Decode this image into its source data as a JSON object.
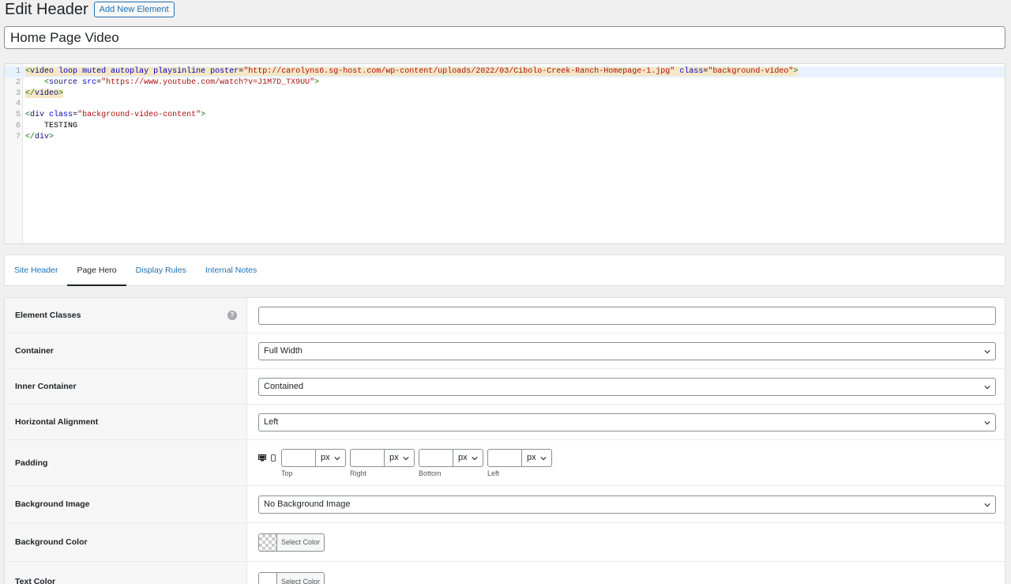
{
  "header": {
    "title": "Edit Header",
    "add_new_label": "Add New Element"
  },
  "element_title": "Home Page Video",
  "code_editor": {
    "line_numbers": [
      "1",
      "2",
      "3",
      "4",
      "5",
      "6",
      "7"
    ],
    "lines": [
      [
        {
          "t": "<",
          "c": "tag hl"
        },
        {
          "t": "video",
          "c": "tagname hl"
        },
        {
          "t": " ",
          "c": "hl"
        },
        {
          "t": "loop",
          "c": "attr hl"
        },
        {
          "t": " ",
          "c": "hl"
        },
        {
          "t": "muted",
          "c": "attr hl"
        },
        {
          "t": " ",
          "c": "hl"
        },
        {
          "t": "autoplay",
          "c": "attr hl"
        },
        {
          "t": " ",
          "c": "hl"
        },
        {
          "t": "playsinline",
          "c": "attr hl"
        },
        {
          "t": " ",
          "c": "hl"
        },
        {
          "t": "poster",
          "c": "attr hl"
        },
        {
          "t": "=",
          "c": "txt hl"
        },
        {
          "t": "\"http://carolyns6.sg-host.com/wp-content/uploads/2022/03/Cibolo-Creek-Ranch-Homepage-1.jpg\"",
          "c": "str hl"
        },
        {
          "t": " ",
          "c": "hl"
        },
        {
          "t": "class",
          "c": "attr hl"
        },
        {
          "t": "=",
          "c": "txt hl"
        },
        {
          "t": "\"background-video\"",
          "c": "str hl"
        },
        {
          "t": ">",
          "c": "tag hl"
        }
      ],
      [
        {
          "t": "    ",
          "c": "txt"
        },
        {
          "t": "<",
          "c": "tag"
        },
        {
          "t": "source",
          "c": "tagname"
        },
        {
          "t": " ",
          "c": "txt"
        },
        {
          "t": "src",
          "c": "attr"
        },
        {
          "t": "=",
          "c": "txt"
        },
        {
          "t": "\"https://www.youtube.com/watch?v=J1M7D_TX9UU\"",
          "c": "str"
        },
        {
          "t": ">",
          "c": "tag"
        }
      ],
      [
        {
          "t": "</",
          "c": "tag hl"
        },
        {
          "t": "video",
          "c": "tagname hl"
        },
        {
          "t": ">",
          "c": "tag hl"
        }
      ],
      [],
      [
        {
          "t": "<",
          "c": "tag"
        },
        {
          "t": "div",
          "c": "tagname"
        },
        {
          "t": " ",
          "c": "txt"
        },
        {
          "t": "class",
          "c": "attr"
        },
        {
          "t": "=",
          "c": "txt"
        },
        {
          "t": "\"background-video-content\"",
          "c": "str"
        },
        {
          "t": ">",
          "c": "tag"
        }
      ],
      [
        {
          "t": "    TESTING",
          "c": "txt"
        }
      ],
      [
        {
          "t": "</",
          "c": "tag"
        },
        {
          "t": "div",
          "c": "tagname"
        },
        {
          "t": ">",
          "c": "tag"
        }
      ]
    ]
  },
  "tabs": [
    {
      "label": "Site Header",
      "active": false
    },
    {
      "label": "Page Hero",
      "active": true
    },
    {
      "label": "Display Rules",
      "active": false
    },
    {
      "label": "Internal Notes",
      "active": false
    }
  ],
  "settings": {
    "element_classes": {
      "label": "Element Classes",
      "value": "",
      "help": "?"
    },
    "container": {
      "label": "Container",
      "value": "Full Width"
    },
    "inner_container": {
      "label": "Inner Container",
      "value": "Contained"
    },
    "horizontal_alignment": {
      "label": "Horizontal Alignment",
      "value": "Left"
    },
    "padding": {
      "label": "Padding",
      "sides": [
        {
          "name": "Top",
          "value": "",
          "unit": "px"
        },
        {
          "name": "Right",
          "value": "",
          "unit": "px"
        },
        {
          "name": "Bottom",
          "value": "",
          "unit": "px"
        },
        {
          "name": "Left",
          "value": "",
          "unit": "px"
        }
      ]
    },
    "background_image": {
      "label": "Background Image",
      "value": "No Background Image"
    },
    "background_color": {
      "label": "Background Color",
      "button_label": "Select Color",
      "swatch": "transparent"
    },
    "text_color": {
      "label": "Text Color",
      "button_label": "Select Color",
      "swatch": "#ffffff"
    }
  },
  "colors": {
    "accent": "#2271b1",
    "page_bg": "#f0f0f1",
    "label_bg": "#f6f6f6"
  }
}
